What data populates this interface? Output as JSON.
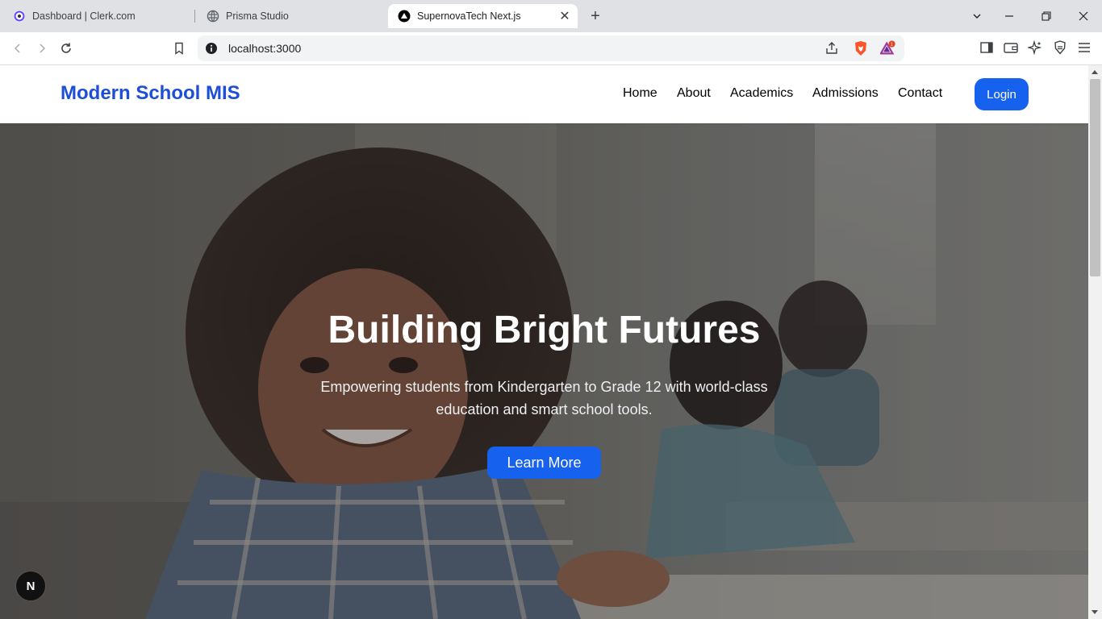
{
  "browser": {
    "tabs": [
      {
        "title": "Dashboard | Clerk.com",
        "icon": "clerk-icon"
      },
      {
        "title": "Prisma Studio",
        "icon": "globe-icon"
      },
      {
        "title": "SupernovaTech Next.js",
        "icon": "nextjs-icon",
        "active": true
      }
    ],
    "url": "localhost:3000",
    "notification_count": "1"
  },
  "site": {
    "brand": "Modern School MIS",
    "nav": [
      "Home",
      "About",
      "Academics",
      "Admissions",
      "Contact"
    ],
    "login_label": "Login"
  },
  "hero": {
    "title": "Building Bright Futures",
    "subtitle": "Empowering students from Kindergarten to Grade 12 with world-class education and smart school tools.",
    "cta_label": "Learn More"
  },
  "dev_badge": "N",
  "colors": {
    "brand": "#1d4ed8",
    "primary_button": "#1662ee"
  }
}
